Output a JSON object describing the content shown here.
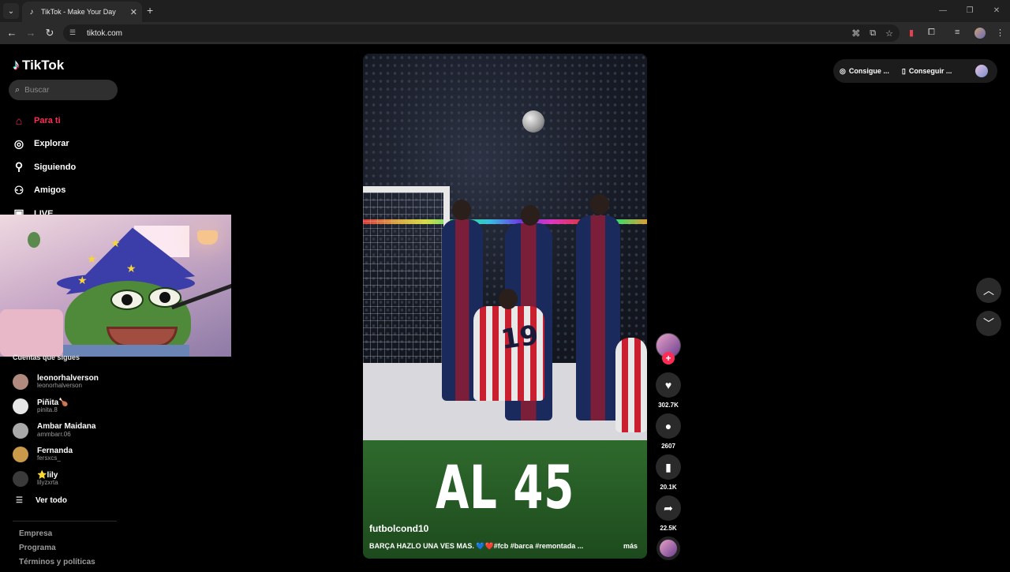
{
  "browser": {
    "tab_title": "TikTok - Make Your Day",
    "url": "tiktok.com"
  },
  "tiktok": {
    "logo_text": "TikTok",
    "search_placeholder": "Buscar",
    "nav": [
      {
        "label": "Para ti",
        "icon": "home-icon",
        "active": true
      },
      {
        "label": "Explorar",
        "icon": "compass-icon"
      },
      {
        "label": "Siguiendo",
        "icon": "user-follow-icon"
      },
      {
        "label": "Amigos",
        "icon": "friends-icon"
      },
      {
        "label": "LIVE",
        "icon": "live-icon"
      }
    ],
    "following_title": "Cuentas que sigues",
    "accounts": [
      {
        "name": "leonorhalverson",
        "handle": "leonorhalverson",
        "color": "#b08a7e"
      },
      {
        "name": "Piñita🍗",
        "handle": "pinita.8",
        "color": "#e6e6e6"
      },
      {
        "name": "Ambar Maidana",
        "handle": "ammbarr.06",
        "color": "#a9a9a9"
      },
      {
        "name": "Fernanda",
        "handle": "fersxcs_",
        "color": "#c99a4a"
      },
      {
        "name": "⭐lily",
        "handle": "lilyzxrta",
        "color": "#3a3a3a"
      }
    ],
    "see_all": "Ver todo",
    "footer": [
      "Empresa",
      "Programa",
      "Términos y políticas"
    ],
    "topbar": {
      "get_coins": "Consigue ...",
      "get_app": "Conseguir ..."
    }
  },
  "video": {
    "overlay_text": "AL 45",
    "jersey_number": "19",
    "username": "futbolcond10",
    "caption": "BARÇA HAZLO UNA VES MAS. 💙❤️#fcb #barca #remontada ...",
    "more": "más",
    "likes": "302.7K",
    "comments": "2607",
    "saves": "20.1K",
    "shares": "22.5K"
  }
}
